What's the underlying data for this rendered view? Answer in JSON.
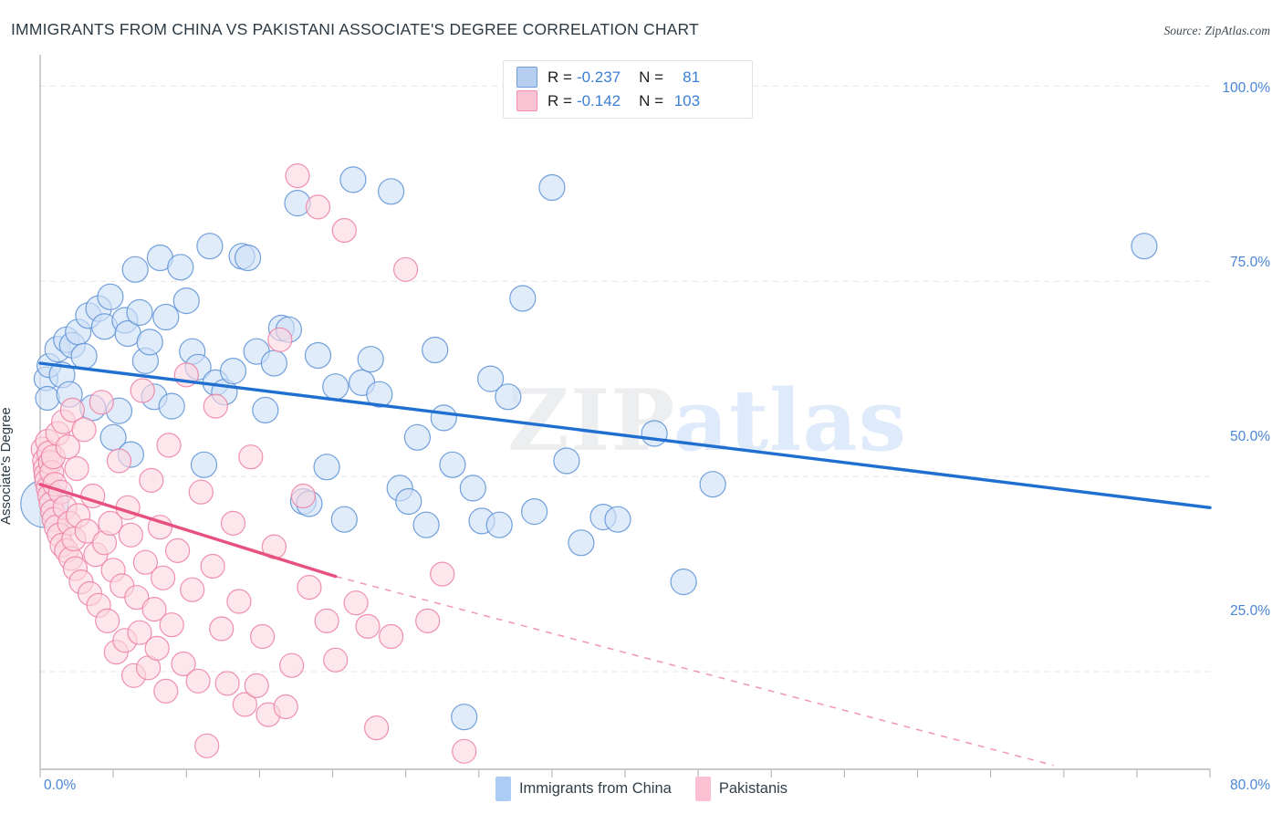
{
  "header": {
    "title": "IMMIGRANTS FROM CHINA VS PAKISTANI ASSOCIATE'S DEGREE CORRELATION CHART",
    "source": "Source: ZipAtlas.com"
  },
  "watermark": {
    "part1": "ZIP",
    "part2": "atlas"
  },
  "legend": {
    "rows": [
      {
        "series": "Immigrants from China",
        "r_label": "R =",
        "r_value": "-0.237",
        "n_label": "N =",
        "n_value": "81",
        "color": "#b6cff0"
      },
      {
        "series": "Pakistanis",
        "r_label": "R =",
        "r_value": "-0.142",
        "n_label": "N =",
        "n_value": "103",
        "color": "#fbc4d4"
      }
    ]
  },
  "bottom_legend": [
    {
      "label": "Immigrants from China",
      "color": "#aaccf5"
    },
    {
      "label": "Pakistanis",
      "color": "#fbc0d2"
    }
  ],
  "chart_data": {
    "type": "scatter",
    "title": "IMMIGRANTS FROM CHINA VS PAKISTANI ASSOCIATE'S DEGREE CORRELATION CHART",
    "xlabel": "",
    "ylabel": "Associate's Degree",
    "xlim": [
      0,
      80
    ],
    "ylim": [
      12.5,
      104
    ],
    "x_ticks": [
      "0.0%",
      "80.0%"
    ],
    "y_ticks": [
      "25.0%",
      "50.0%",
      "75.0%",
      "100.0%"
    ],
    "y_tick_values": [
      25,
      50,
      75,
      100
    ],
    "grid": "horizontal-dashed",
    "legend_position": "top-center",
    "series": [
      {
        "name": "Immigrants from China",
        "color": "#cfe1f7",
        "stroke": "#5b91d6",
        "R": -0.237,
        "N": 81,
        "trendline": {
          "x0": 0,
          "y0": 64.5,
          "x1": 80,
          "y1": 46.0,
          "style": "solid",
          "color": "#1f6fd0"
        },
        "points": [
          [
            0.3,
            46.5,
            26
          ],
          [
            0.4,
            62.5,
            13
          ],
          [
            0.5,
            60.0,
            13
          ],
          [
            0.6,
            64.2,
            13
          ],
          [
            1.2,
            66.3,
            14
          ],
          [
            1.5,
            63.0,
            14
          ],
          [
            1.8,
            67.5,
            14
          ],
          [
            2.0,
            60.5,
            14
          ],
          [
            2.2,
            66.8,
            14
          ],
          [
            2.6,
            68.5,
            14
          ],
          [
            3.0,
            65.4,
            14
          ],
          [
            3.3,
            70.6,
            14
          ],
          [
            3.6,
            58.8,
            14
          ],
          [
            4.0,
            71.5,
            14
          ],
          [
            4.4,
            69.2,
            14
          ],
          [
            4.8,
            73.0,
            14
          ],
          [
            5.0,
            55.0,
            14
          ],
          [
            5.4,
            58.4,
            14
          ],
          [
            5.8,
            70.0,
            14
          ],
          [
            6.0,
            68.3,
            14
          ],
          [
            6.2,
            52.8,
            14
          ],
          [
            6.5,
            76.5,
            14
          ],
          [
            6.8,
            71.0,
            14
          ],
          [
            7.2,
            64.8,
            14
          ],
          [
            7.5,
            67.2,
            14
          ],
          [
            7.8,
            60.2,
            14
          ],
          [
            8.2,
            78.0,
            14
          ],
          [
            8.6,
            70.4,
            14
          ],
          [
            9.0,
            59.0,
            14
          ],
          [
            9.6,
            76.8,
            14
          ],
          [
            10.0,
            72.5,
            14
          ],
          [
            10.4,
            66.0,
            14
          ],
          [
            10.8,
            64.0,
            14
          ],
          [
            11.2,
            51.5,
            14
          ],
          [
            11.6,
            79.5,
            14
          ],
          [
            12.0,
            62.0,
            14
          ],
          [
            12.6,
            60.8,
            14
          ],
          [
            13.2,
            63.5,
            14
          ],
          [
            13.8,
            78.2,
            14
          ],
          [
            14.2,
            78.0,
            14
          ],
          [
            14.8,
            66.0,
            14
          ],
          [
            15.4,
            58.5,
            14
          ],
          [
            16.0,
            64.5,
            14
          ],
          [
            16.5,
            69.0,
            14
          ],
          [
            17.0,
            68.8,
            14
          ],
          [
            17.6,
            85.0,
            14
          ],
          [
            18.0,
            46.8,
            14
          ],
          [
            18.4,
            46.5,
            14
          ],
          [
            19.0,
            65.5,
            14
          ],
          [
            19.6,
            51.2,
            14
          ],
          [
            20.2,
            61.5,
            14
          ],
          [
            20.8,
            44.5,
            14
          ],
          [
            21.4,
            88.0,
            14
          ],
          [
            22.0,
            62.0,
            14
          ],
          [
            22.6,
            65.0,
            14
          ],
          [
            23.2,
            60.5,
            14
          ],
          [
            24.0,
            86.5,
            14
          ],
          [
            24.6,
            48.5,
            14
          ],
          [
            25.2,
            46.8,
            14
          ],
          [
            25.8,
            55.0,
            14
          ],
          [
            26.4,
            43.8,
            14
          ],
          [
            27.0,
            66.2,
            14
          ],
          [
            27.6,
            57.5,
            14
          ],
          [
            28.2,
            51.5,
            14
          ],
          [
            29.0,
            19.2,
            14
          ],
          [
            29.6,
            48.5,
            14
          ],
          [
            30.2,
            44.3,
            14
          ],
          [
            30.8,
            62.5,
            14
          ],
          [
            31.4,
            43.8,
            14
          ],
          [
            32.0,
            60.2,
            14
          ],
          [
            33.0,
            72.8,
            14
          ],
          [
            33.8,
            45.5,
            14
          ],
          [
            35.0,
            87.0,
            14
          ],
          [
            36.0,
            52.0,
            14
          ],
          [
            37.0,
            41.5,
            14
          ],
          [
            38.5,
            44.8,
            14
          ],
          [
            39.5,
            44.5,
            14
          ],
          [
            42.0,
            55.5,
            14
          ],
          [
            44.0,
            36.5,
            14
          ],
          [
            46.0,
            49.0,
            14
          ],
          [
            75.5,
            79.5,
            14
          ]
        ]
      },
      {
        "name": "Pakistanis",
        "color": "#fcd6e1",
        "stroke": "#ec7fa3",
        "R": -0.142,
        "N": 103,
        "trendline": {
          "x0": 0,
          "y0": 49.0,
          "x1": 20.2,
          "y1": 37.2,
          "style": "solid-then-dashed",
          "dash_end_x": 69.3,
          "dash_end_y": 13.0,
          "color": "#e8507f"
        },
        "points": [
          [
            0.2,
            53.5,
            13
          ],
          [
            0.3,
            52.0,
            13
          ],
          [
            0.35,
            51.0,
            13
          ],
          [
            0.4,
            50.2,
            13
          ],
          [
            0.45,
            49.4,
            13
          ],
          [
            0.5,
            54.5,
            13
          ],
          [
            0.55,
            48.5,
            13
          ],
          [
            0.6,
            53.0,
            13
          ],
          [
            0.65,
            47.5,
            13
          ],
          [
            0.7,
            51.8,
            13
          ],
          [
            0.75,
            46.5,
            13
          ],
          [
            0.8,
            50.5,
            13
          ],
          [
            0.85,
            45.5,
            13
          ],
          [
            0.9,
            52.5,
            13
          ],
          [
            0.95,
            44.5,
            13
          ],
          [
            1.0,
            49.0,
            13
          ],
          [
            1.1,
            43.5,
            13
          ],
          [
            1.2,
            55.5,
            13
          ],
          [
            1.3,
            42.5,
            13
          ],
          [
            1.4,
            48.0,
            13
          ],
          [
            1.5,
            41.2,
            13
          ],
          [
            1.6,
            57.0,
            13
          ],
          [
            1.7,
            46.0,
            13
          ],
          [
            1.8,
            40.5,
            13
          ],
          [
            1.9,
            53.8,
            13
          ],
          [
            2.0,
            44.0,
            13
          ],
          [
            2.1,
            39.5,
            13
          ],
          [
            2.2,
            58.5,
            13
          ],
          [
            2.3,
            42.0,
            13
          ],
          [
            2.4,
            38.2,
            13
          ],
          [
            2.5,
            51.0,
            13
          ],
          [
            2.6,
            45.0,
            13
          ],
          [
            2.8,
            36.5,
            13
          ],
          [
            3.0,
            56.0,
            13
          ],
          [
            3.2,
            43.0,
            13
          ],
          [
            3.4,
            35.0,
            13
          ],
          [
            3.6,
            47.5,
            13
          ],
          [
            3.8,
            40.0,
            13
          ],
          [
            4.0,
            33.5,
            13
          ],
          [
            4.2,
            59.5,
            13
          ],
          [
            4.4,
            41.5,
            13
          ],
          [
            4.6,
            31.5,
            13
          ],
          [
            4.8,
            44.0,
            13
          ],
          [
            5.0,
            38.0,
            13
          ],
          [
            5.2,
            27.5,
            13
          ],
          [
            5.4,
            52.0,
            13
          ],
          [
            5.6,
            36.0,
            13
          ],
          [
            5.8,
            29.0,
            13
          ],
          [
            6.0,
            46.0,
            13
          ],
          [
            6.2,
            42.5,
            13
          ],
          [
            6.4,
            24.5,
            13
          ],
          [
            6.6,
            34.5,
            13
          ],
          [
            6.8,
            30.0,
            13
          ],
          [
            7.0,
            61.0,
            13
          ],
          [
            7.2,
            39.0,
            13
          ],
          [
            7.4,
            25.5,
            13
          ],
          [
            7.6,
            49.5,
            13
          ],
          [
            7.8,
            33.0,
            13
          ],
          [
            8.0,
            28.0,
            13
          ],
          [
            8.2,
            43.5,
            13
          ],
          [
            8.4,
            37.0,
            13
          ],
          [
            8.6,
            22.5,
            13
          ],
          [
            8.8,
            54.0,
            13
          ],
          [
            9.0,
            31.0,
            13
          ],
          [
            9.4,
            40.5,
            13
          ],
          [
            9.8,
            26.0,
            13
          ],
          [
            10.0,
            63.0,
            13
          ],
          [
            10.4,
            35.5,
            13
          ],
          [
            10.8,
            23.8,
            13
          ],
          [
            11.0,
            48.0,
            13
          ],
          [
            11.4,
            15.5,
            13
          ],
          [
            11.8,
            38.5,
            13
          ],
          [
            12.0,
            59.0,
            13
          ],
          [
            12.4,
            30.5,
            13
          ],
          [
            12.8,
            23.5,
            13
          ],
          [
            13.2,
            44.0,
            13
          ],
          [
            13.6,
            34.0,
            13
          ],
          [
            14.0,
            20.8,
            13
          ],
          [
            14.4,
            52.5,
            13
          ],
          [
            14.8,
            23.2,
            13
          ],
          [
            15.2,
            29.5,
            13
          ],
          [
            15.6,
            19.5,
            13
          ],
          [
            16.0,
            41.0,
            13
          ],
          [
            16.4,
            67.5,
            13
          ],
          [
            16.8,
            20.5,
            13
          ],
          [
            17.2,
            25.8,
            13
          ],
          [
            17.6,
            88.5,
            13
          ],
          [
            18.0,
            47.5,
            13
          ],
          [
            18.4,
            35.8,
            13
          ],
          [
            19.0,
            84.5,
            13
          ],
          [
            19.6,
            31.5,
            13
          ],
          [
            20.2,
            26.5,
            13
          ],
          [
            20.8,
            81.5,
            13
          ],
          [
            21.6,
            33.8,
            13
          ],
          [
            22.4,
            30.8,
            13
          ],
          [
            23.0,
            17.8,
            13
          ],
          [
            24.0,
            29.5,
            13
          ],
          [
            25.0,
            76.5,
            13
          ],
          [
            26.5,
            31.5,
            13
          ],
          [
            27.5,
            37.5,
            13
          ],
          [
            29.0,
            14.8,
            13
          ]
        ]
      }
    ]
  },
  "axis": {
    "y_labels": [
      "100.0%",
      "75.0%",
      "50.0%",
      "25.0%"
    ],
    "x_left": "0.0%",
    "x_right": "80.0%",
    "y_title": "Associate's Degree"
  }
}
